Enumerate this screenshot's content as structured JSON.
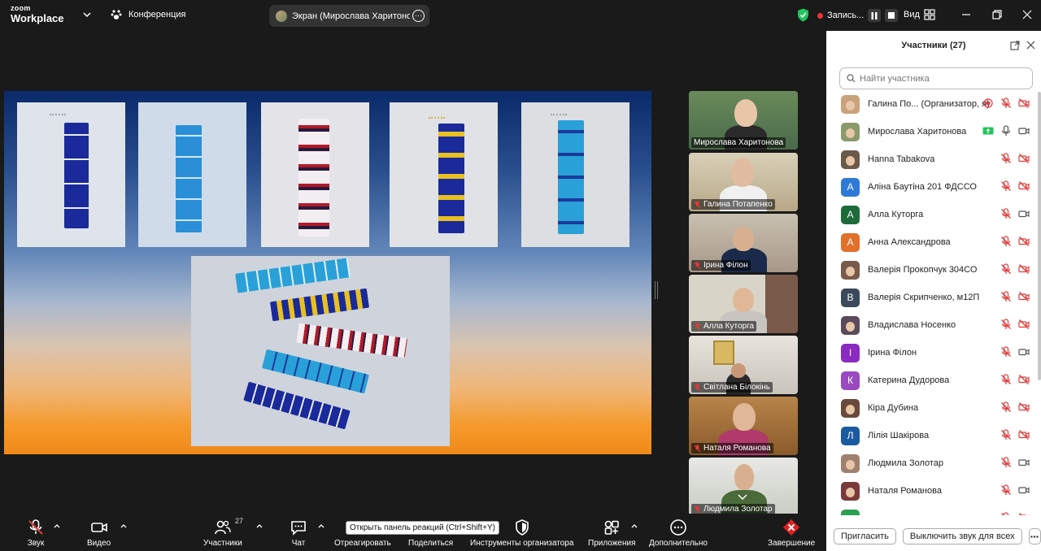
{
  "app": {
    "logo_line1": "zoom",
    "logo_line2": "Workplace",
    "conference_label": "Конференция"
  },
  "share": {
    "label": "Экран (Мирослава Харитонова"
  },
  "recording": {
    "label": "Запись..."
  },
  "view": {
    "label": "Вид"
  },
  "tiles": [
    {
      "name": "Мирослава Харитонова",
      "muted": false,
      "active": true
    },
    {
      "name": "Галина Потапенко",
      "muted": true
    },
    {
      "name": "Ірина Філон",
      "muted": true
    },
    {
      "name": "Алла Куторга",
      "muted": true
    },
    {
      "name": "Світлана Білокінь",
      "muted": true
    },
    {
      "name": "Наталя Романова",
      "muted": true
    },
    {
      "name": "Людмила Золотар",
      "muted": true
    }
  ],
  "panel": {
    "title": "Участники (27)",
    "search_placeholder": "Найти участника",
    "participants": [
      {
        "name": "Галина По... (Организатор, я)",
        "avatar": "photo",
        "color": "#c9a27a",
        "letter": "",
        "recording": true,
        "mic": "off",
        "video": "off"
      },
      {
        "name": "Мирослава Харитонова",
        "avatar": "photo",
        "color": "#8a9a6a",
        "letter": "",
        "sharing": true,
        "mic": "on",
        "video": "on"
      },
      {
        "name": "Нanna Tabakova",
        "avatar": "photo",
        "color": "#6b5a4a",
        "letter": "",
        "mic": "off",
        "video": "off"
      },
      {
        "name": "Аліна Баутіна 201 ФДССО",
        "avatar": "letter",
        "color": "#2d7bd6",
        "letter": "А",
        "mic": "off",
        "video": "off"
      },
      {
        "name": "Алла Куторга",
        "avatar": "letter",
        "color": "#1e6b3a",
        "letter": "А",
        "mic": "off",
        "video": "on"
      },
      {
        "name": "Анна Александрова",
        "avatar": "letter",
        "color": "#e0702a",
        "letter": "А",
        "mic": "off",
        "video": "off"
      },
      {
        "name": "Валерія Прокопчук 304СО",
        "avatar": "photo",
        "color": "#7a5a4a",
        "letter": "",
        "mic": "off",
        "video": "off"
      },
      {
        "name": "Валерія Скрипченко, м12П",
        "avatar": "letter",
        "color": "#3a4a5a",
        "letter": "В",
        "mic": "off",
        "video": "off"
      },
      {
        "name": "Владислава Носенко",
        "avatar": "photo",
        "color": "#5a4a5a",
        "letter": "",
        "mic": "off",
        "video": "off"
      },
      {
        "name": "Ірина Філон",
        "avatar": "letter",
        "color": "#8a2ac0",
        "letter": "І",
        "mic": "off",
        "video": "on"
      },
      {
        "name": "Катерина Дудорова",
        "avatar": "letter",
        "color": "#9a4ac0",
        "letter": "К",
        "mic": "off",
        "video": "off"
      },
      {
        "name": "Кіра Дубина",
        "avatar": "photo",
        "color": "#6a4a3a",
        "letter": "",
        "mic": "off",
        "video": "off"
      },
      {
        "name": "Лілія Шакірова",
        "avatar": "letter",
        "color": "#1a5aa0",
        "letter": "Л",
        "mic": "off",
        "video": "off"
      },
      {
        "name": "Людмила Золотар",
        "avatar": "photo",
        "color": "#a08070",
        "letter": "",
        "mic": "off",
        "video": "on"
      },
      {
        "name": "Наталя Романова",
        "avatar": "photo",
        "color": "#7a3a3a",
        "letter": "",
        "mic": "off",
        "video": "on"
      },
      {
        "name": "",
        "avatar": "letter",
        "color": "#2aa050",
        "letter": "",
        "mic": "off",
        "video": "off"
      }
    ],
    "invite_label": "Пригласить",
    "mute_all_label": "Выключить звук для всех"
  },
  "toolbar": {
    "audio": "Звук",
    "video": "Видео",
    "participants": "Участники",
    "participants_count": "27",
    "chat": "Чат",
    "react": "Отреагировать",
    "share": "Поделиться",
    "host_tools": "Инструменты организатора",
    "apps": "Приложения",
    "more": "Дополнительно",
    "end": "Завершение",
    "tooltip": "Открыть панель реакций (Ctrl+Shift+Y)"
  },
  "colors": {
    "accent_green": "#23d160",
    "mute_red": "#e03a3a",
    "end_red": "#e02020"
  }
}
